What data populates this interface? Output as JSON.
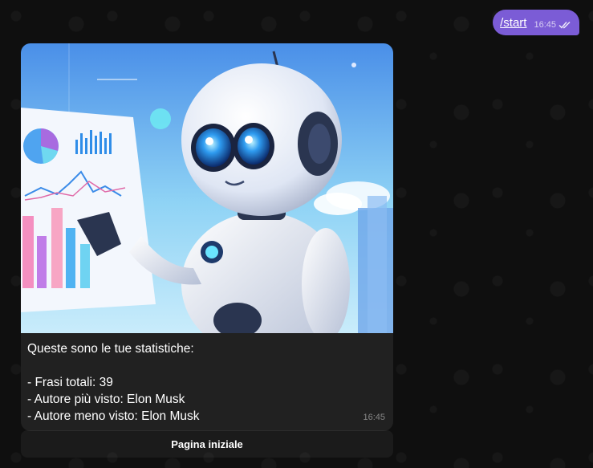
{
  "outgoing": {
    "text": "/start",
    "time": "16:45",
    "status_icon": "double-check-icon"
  },
  "incoming": {
    "image_description_icon": "robot-statistics-illustration",
    "caption_lines": [
      "Queste sono le tue statistiche:",
      "",
      "- Frasi totali: 39",
      "- Autore più visto: Elon Musk",
      "- Autore meno visto: Elon Musk"
    ],
    "time": "16:45"
  },
  "keyboard": {
    "button_label": "Pagina iniziale"
  },
  "colors": {
    "outgoing_bubble": "#7b5cd6",
    "incoming_bubble": "#212121",
    "background": "#0f0f0f"
  }
}
